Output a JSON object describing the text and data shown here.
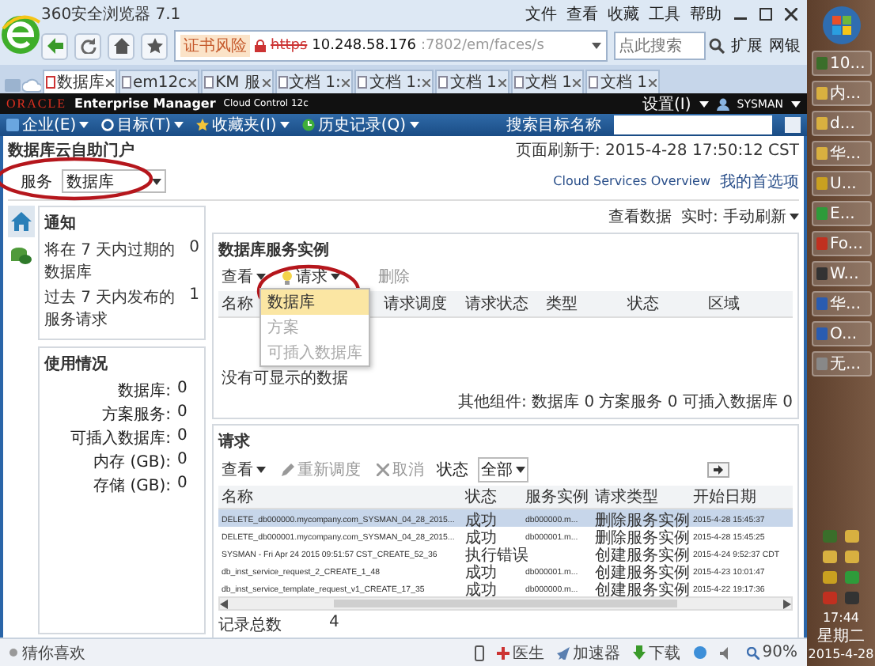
{
  "browser": {
    "title": "360安全浏览器 7.1",
    "menu": [
      "文件",
      "查看",
      "收藏",
      "工具",
      "帮助"
    ],
    "cert_warning": "证书风险",
    "url_scheme": "https",
    "url_host": "10.248.58.176",
    "url_rest": ":7802/em/faces/s",
    "search_placeholder": "点此搜索",
    "extensions": "扩展",
    "netbank": "网银",
    "tabs": [
      {
        "label": "数据库",
        "selected": true
      },
      {
        "label": "em12c",
        "selected": false
      },
      {
        "label": "KM 服",
        "selected": false
      },
      {
        "label": "文档 1:",
        "selected": false
      },
      {
        "label": "文档 1:",
        "selected": false
      },
      {
        "label": "文档 1",
        "selected": false
      },
      {
        "label": "文档 1",
        "selected": false
      },
      {
        "label": "文档 1",
        "selected": false
      }
    ]
  },
  "em_header": {
    "brand": "ORACLE",
    "product": "Enterprise Manager",
    "edition": "Cloud Control 12c",
    "setup": "设置(I)",
    "user": "SYSMAN"
  },
  "em_nav": {
    "items": [
      "企业(E)",
      "目标(T)",
      "收藏夹(I)",
      "历史记录(Q)"
    ],
    "search_label": "搜索目标名称"
  },
  "page": {
    "title": "数据库云自助门户",
    "refreshed": "页面刷新于: 2015-4-28 17:50:12 CST",
    "links": [
      "Cloud Services Overview",
      "我的首选项"
    ],
    "service_label": "服务",
    "service_value": "数据库"
  },
  "sidebar": {
    "items": [
      {
        "kind": "home",
        "selected": true
      },
      {
        "kind": "database",
        "selected": false
      }
    ]
  },
  "notifications": {
    "title": "通知",
    "rows": [
      {
        "label": "将在 7 天内过期的数据库",
        "value": "0"
      },
      {
        "label": "过去 7 天内发布的服务请求",
        "value": "1"
      }
    ]
  },
  "usage": {
    "title": "使用情况",
    "rows": [
      {
        "label": "数据库:",
        "value": "0"
      },
      {
        "label": "方案服务:",
        "value": "0"
      },
      {
        "label": "可插入数据库:",
        "value": "0"
      },
      {
        "label": "内存 (GB):",
        "value": "0"
      },
      {
        "label": "存储 (GB):",
        "value": "0"
      }
    ]
  },
  "view_data": {
    "label": "查看数据",
    "value": "实时: 手动刷新"
  },
  "instances": {
    "title": "数据库服务实例",
    "view": "查看",
    "request": "请求",
    "delete": "删除",
    "menu": [
      {
        "label": "数据库",
        "selected": true,
        "disabled": false
      },
      {
        "label": "方案",
        "selected": false,
        "disabled": true
      },
      {
        "label": "可插入数据库",
        "selected": false,
        "disabled": true
      }
    ],
    "columns": [
      "名称",
      "请求调度",
      "请求状态",
      "类型",
      "状态",
      "区域"
    ],
    "empty": "没有可显示的数据",
    "footer": "其他组件: 数据库 0 方案服务 0 可插入数据库 0"
  },
  "requests": {
    "title": "请求",
    "view": "查看",
    "reschedule": "重新调度",
    "cancel": "取消",
    "status_label": "状态",
    "status_value": "全部",
    "columns": [
      "名称",
      "状态",
      "服务实例",
      "请求类型",
      "开始日期"
    ],
    "rows": [
      {
        "selected": true,
        "cells": [
          "DELETE_db000000.mycompany.com_SYSMAN_04_28_2015...",
          "成功",
          "db000000.m...",
          "删除服务实例",
          "2015-4-28 15:45:37"
        ]
      },
      {
        "selected": false,
        "cells": [
          "DELETE_db000001.mycompany.com_SYSMAN_04_28_2015...",
          "成功",
          "db000001.m...",
          "删除服务实例",
          "2015-4-28 15:45:25"
        ]
      },
      {
        "selected": false,
        "cells": [
          "SYSMAN - Fri Apr 24 2015 09:51:57 CST_CREATE_52_36",
          "执行错误",
          "",
          "创建服务实例",
          "2015-4-24 9:52:37 CDT"
        ]
      },
      {
        "selected": false,
        "cells": [
          "db_inst_service_request_2_CREATE_1_48",
          "成功",
          "db000001.m...",
          "创建服务实例",
          "2015-4-23 10:01:47"
        ]
      },
      {
        "selected": false,
        "cells": [
          "db_inst_service_template_request_v1_CREATE_17_35",
          "成功",
          "db000000.m...",
          "创建服务实例",
          "2015-4-22 19:17:36"
        ]
      }
    ],
    "footer_label": "记录总数",
    "footer_value": "4"
  },
  "status_bar": {
    "left": "猜你喜欢",
    "items": [
      "医生",
      "加速器",
      "下载"
    ],
    "zoom": "90%"
  },
  "taskbar": {
    "items": [
      "10...",
      "内...",
      "d...",
      "华...",
      "U...",
      "E...",
      "Fo...",
      "W...",
      "华...",
      "O...",
      "无..."
    ],
    "time": "17:44",
    "weekday": "星期二",
    "date": "2015-4-28"
  }
}
